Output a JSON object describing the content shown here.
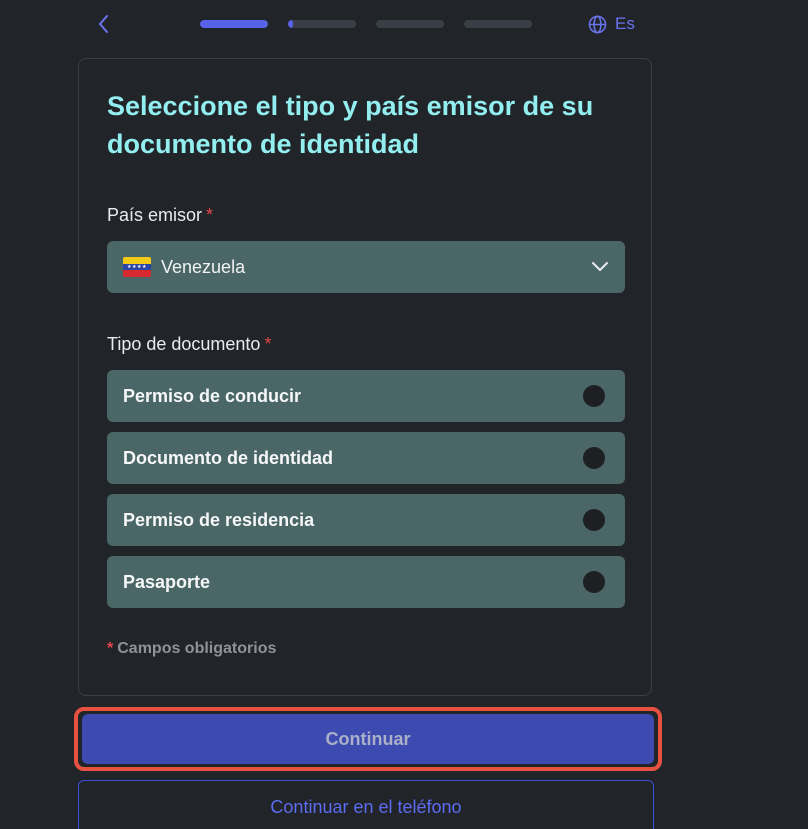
{
  "header": {
    "back_icon": "chevron-left-icon",
    "progress_steps": [
      {
        "fill": 1.0
      },
      {
        "fill": 0.08
      },
      {
        "fill": 0
      },
      {
        "fill": 0
      }
    ],
    "language": "Es",
    "language_icon": "globe-icon"
  },
  "form": {
    "title": "Seleccione el tipo y país emisor de su documento de identidad",
    "country_label": "País emisor",
    "country_required": "*",
    "country_value": "Venezuela",
    "country_flag_icon": "venezuela-flag-icon",
    "doc_type_label": "Tipo de documento",
    "doc_type_required": "*",
    "doc_types": [
      {
        "label": "Permiso de conducir",
        "selected": false
      },
      {
        "label": "Documento de identidad",
        "selected": false
      },
      {
        "label": "Permiso de residencia",
        "selected": false
      },
      {
        "label": "Pasaporte",
        "selected": false
      }
    ],
    "required_mark": "*",
    "required_note": "Campos obligatorios"
  },
  "actions": {
    "continue_label": "Continuar",
    "continue_phone_label": "Continuar en el teléfono"
  },
  "colors": {
    "accent": "#5862e8",
    "title": "#93eef0",
    "field_bg": "#4a6667",
    "required": "#e6474a",
    "highlight": "#e8503f"
  }
}
